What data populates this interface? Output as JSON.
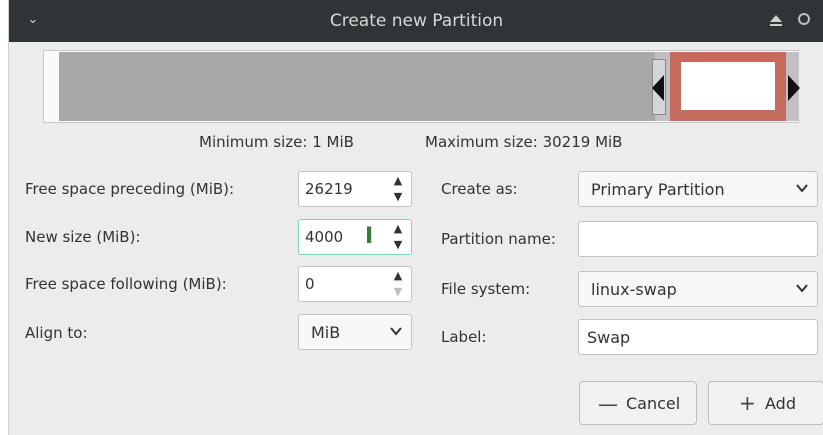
{
  "window": {
    "title": "Create new Partition",
    "menu_glyph": "⌄"
  },
  "info": {
    "min_size": "Minimum size: 1 MiB",
    "max_size": "Maximum size: 30219 MiB"
  },
  "left_form": {
    "free_before_label": "Free space preceding (MiB):",
    "free_before_value": "26219",
    "new_size_label": "New size (MiB):",
    "new_size_value": "4000",
    "free_after_label": "Free space following (MiB):",
    "free_after_value": "0",
    "align_label": "Align to:",
    "align_value": "MiB"
  },
  "right_form": {
    "create_as_label": "Create as:",
    "create_as_value": "Primary Partition",
    "partition_name_label": "Partition name:",
    "partition_name_value": "",
    "file_system_label": "File system:",
    "file_system_value": "linux-swap",
    "label_label": "Label:",
    "label_value": "Swap"
  },
  "buttons": {
    "cancel_label": "Cancel",
    "cancel_icon": "—",
    "add_label": "Add",
    "add_icon": "+"
  },
  "colors": {
    "selected_partition": "#c56b5e",
    "unallocated": "#a8a8a8",
    "titlebar": "#2f3436"
  }
}
